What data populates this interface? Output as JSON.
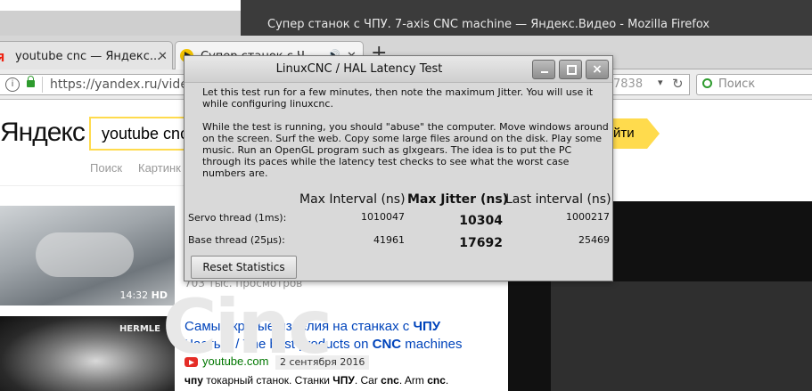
{
  "window": {
    "title": "Супер станок с ЧПУ. 7-axis CNC machine — Яндекс.Видео - Mozilla Firefox"
  },
  "tabs": [
    {
      "label": "youtube cnc — Яндекс...",
      "favicon": "yandex-y-icon",
      "active": false
    },
    {
      "label": "Супер станок с Ч",
      "favicon": "play-icon",
      "active": true
    }
  ],
  "navbar": {
    "url": "https://yandex.ru/video",
    "url_fragment": "7838",
    "search_placeholder": "Поиск"
  },
  "yandex": {
    "logo": "Яндекс",
    "query": "youtube cnc",
    "find_button": "йти",
    "nav": [
      "Поиск",
      "Картинк"
    ],
    "result1": {
      "duration": "14:32",
      "quality": "HD",
      "views": "703 тыс. просмотров"
    },
    "result2": {
      "title_line1_pre": "Самые крутые изделия на станках с ",
      "title_line1_bold": "ЧПУ",
      "title_line2_pre": "Часть 2 / The best products on ",
      "title_line2_bold": "CNC",
      "title_line2_post": " machines",
      "host": "youtube.com",
      "date": "2 сентября 2016",
      "snippet_b1": "чпу",
      "snippet_t1": " токарный станок. Станки ",
      "snippet_b2": "ЧПУ",
      "snippet_t2": ". Car ",
      "snippet_b3": "cnc",
      "snippet_t3": ". Arm ",
      "snippet_b4": "cnc",
      "snippet_t4": ".",
      "watermark": "HERMLE"
    },
    "video_overlay_text": "Cinc"
  },
  "dialog": {
    "title": "LinuxCNC / HAL Latency Test",
    "text": "Let this test run for a few minutes, then note the maximum Jitter.  You will use it while configuring linuxcnc.\n\nWhile the test is running, you should \"abuse\" the computer. Move windows around on the screen. Surf the web. Copy some large files around on the disk. Play some music. Run an OpenGL program such as glxgears. The idea is to put the PC through its paces while the latency test checks to see what the worst case numbers are.",
    "columns": {
      "max_interval": "Max Interval (ns)",
      "max_jitter": "Max Jitter (ns)",
      "last_interval": "Last interval (ns)"
    },
    "rows": [
      {
        "label": "Servo thread (1ms):",
        "max_interval": "1010047",
        "max_jitter": "10304",
        "last_interval": "1000217"
      },
      {
        "label": "Base thread (25µs):",
        "max_interval": "41961",
        "max_jitter": "17692",
        "last_interval": "25469"
      }
    ],
    "reset_button": "Reset Statistics",
    "controls": {
      "minimize": "minimize-icon",
      "maximize": "maximize-icon",
      "close": "×"
    }
  }
}
